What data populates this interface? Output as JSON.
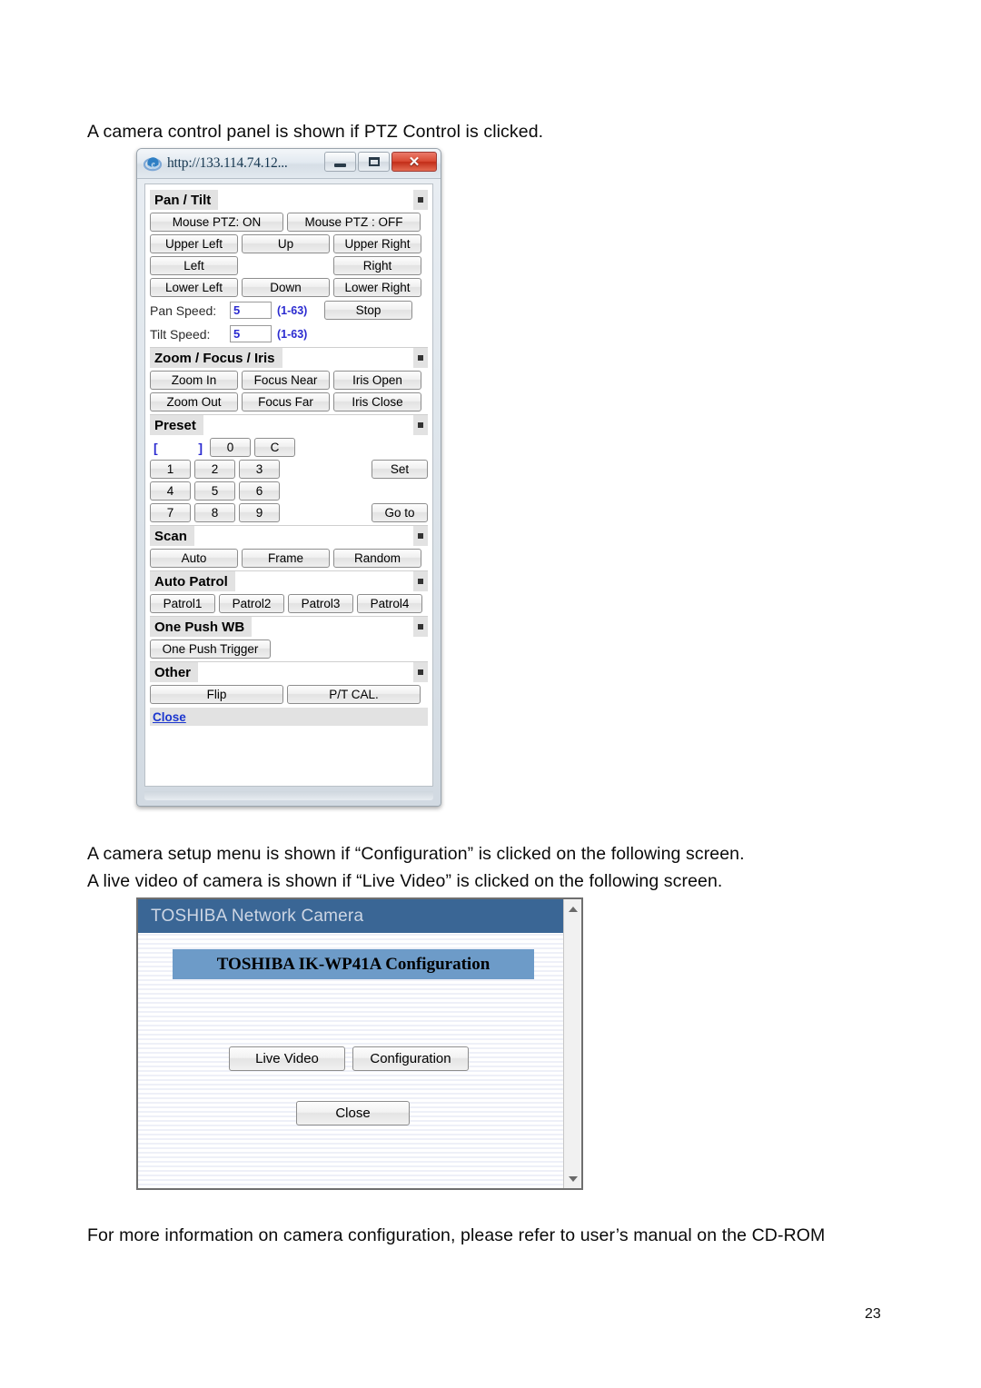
{
  "document": {
    "intro_paragraph": "A camera control panel is shown if PTZ Control is clicked.",
    "middle_paragraph_line1": "A camera setup menu is shown if “Configuration” is clicked on the following screen.",
    "middle_paragraph_line2": "A live video of camera is shown if “Live Video” is clicked on the following screen.",
    "footer_paragraph": "For more information on camera configuration, please refer to user’s manual on the CD-ROM",
    "page_number": "23"
  },
  "ptz_window": {
    "title": "http://133.114.74.12...",
    "icons": {
      "app_icon": "internet-explorer-icon",
      "minimize": "minimize-icon",
      "maximize": "maximize-icon",
      "close": "close-icon"
    },
    "window_buttons": {
      "minimize_label": "",
      "maximize_label": "",
      "close_label": "✕"
    },
    "sections": {
      "pan_tilt": {
        "title": "Pan / Tilt",
        "toggle": "collapse-icon",
        "mouse_ptz_on": "Mouse PTZ: ON",
        "mouse_ptz_off": "Mouse PTZ : OFF",
        "upper_left": "Upper Left",
        "up": "Up",
        "upper_right": "Upper Right",
        "left": "Left",
        "right": "Right",
        "lower_left": "Lower Left",
        "down": "Down",
        "lower_right": "Lower Right",
        "pan_speed_label": "Pan Speed:",
        "pan_speed_value": "5",
        "pan_speed_range": "(1-63)",
        "tilt_speed_label": "Tilt Speed:",
        "tilt_speed_value": "5",
        "tilt_speed_range": "(1-63)",
        "stop": "Stop"
      },
      "zoom_focus_iris": {
        "title": "Zoom / Focus / Iris",
        "toggle": "collapse-icon",
        "zoom_in": "Zoom In",
        "focus_near": "Focus Near",
        "iris_open": "Iris Open",
        "zoom_out": "Zoom Out",
        "focus_far": "Focus Far",
        "iris_close": "Iris Close"
      },
      "preset": {
        "title": "Preset",
        "toggle": "collapse-icon",
        "field_open": "[",
        "field_close": "]",
        "field_value": "",
        "key_0": "0",
        "key_c": "C",
        "key_1": "1",
        "key_2": "2",
        "key_3": "3",
        "key_4": "4",
        "key_5": "5",
        "key_6": "6",
        "key_7": "7",
        "key_8": "8",
        "key_9": "9",
        "set": "Set",
        "go_to": "Go to"
      },
      "scan": {
        "title": "Scan",
        "toggle": "collapse-icon",
        "auto": "Auto",
        "frame": "Frame",
        "random": "Random"
      },
      "auto_patrol": {
        "title": "Auto Patrol",
        "toggle": "collapse-icon",
        "patrol1": "Patrol1",
        "patrol2": "Patrol2",
        "patrol3": "Patrol3",
        "patrol4": "Patrol4"
      },
      "one_push_wb": {
        "title": "One Push WB",
        "toggle": "collapse-icon",
        "one_push_trigger": "One Push Trigger"
      },
      "other": {
        "title": "Other",
        "toggle": "collapse-icon",
        "flip": "Flip",
        "pt_cal": "P/T CAL."
      }
    },
    "close_link": "Close"
  },
  "toshiba_window": {
    "banner": "TOSHIBA Network Camera",
    "config_title": "TOSHIBA IK-WP41A Configuration",
    "live_video_button": "Live Video",
    "configuration_button": "Configuration",
    "close_button": "Close",
    "scrollbar": {
      "up_arrow": "scroll-up-icon",
      "down_arrow": "scroll-down-icon"
    }
  },
  "colors": {
    "banner_blue": "#3a6695",
    "config_title_blue": "#6d9bc8",
    "link_blue": "#1b36cf",
    "value_blue": "#2b2bd0",
    "close_button_red": "#d94a33"
  }
}
